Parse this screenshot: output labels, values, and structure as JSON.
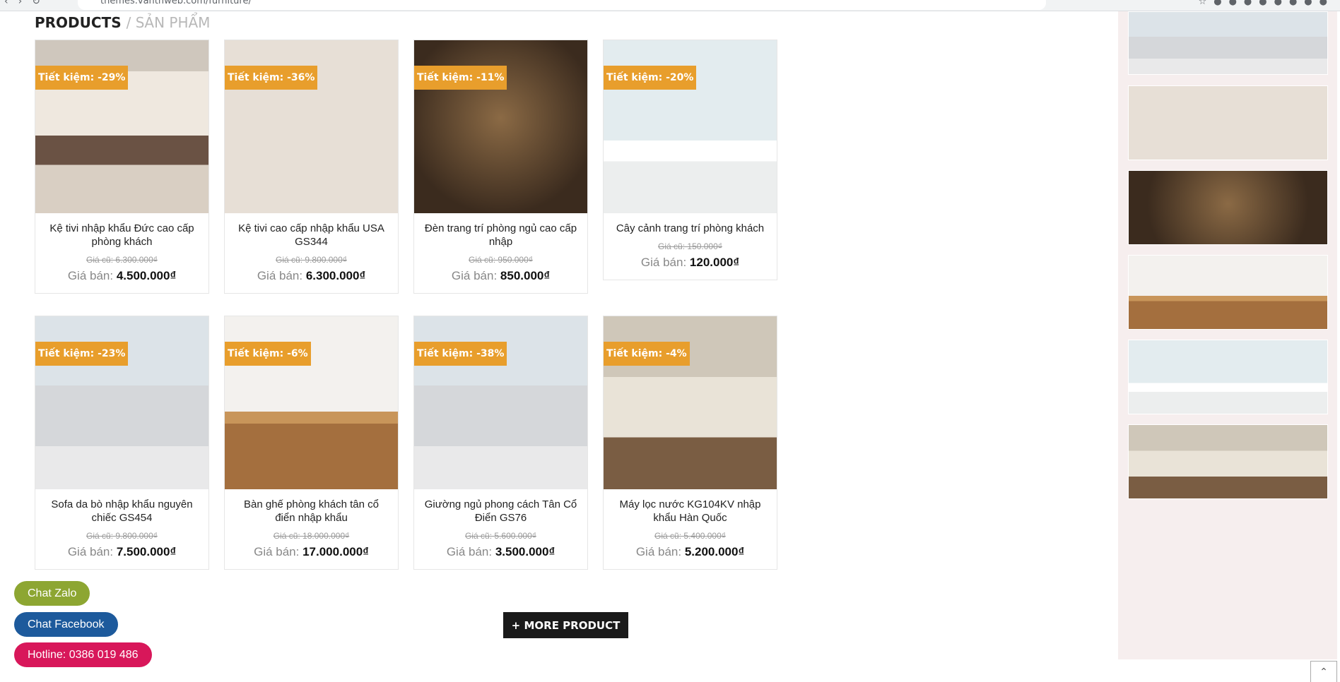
{
  "browser": {
    "url": "themes.vanthweb.com/furniture/"
  },
  "section": {
    "title_en": "PRODUCTS",
    "title_vi": "/ SẢN PHẨM"
  },
  "products": [
    {
      "badge": "Tiết kiệm: -29%",
      "name": "Kệ tivi nhập khẩu Đức cao cấp phòng khách",
      "old_price": "Giá cũ: 6.300.000₫",
      "price_label": "Giá bán:",
      "price": "4.500.000₫",
      "image": "living-room"
    },
    {
      "badge": "Tiết kiệm: -36%",
      "name": "Kệ tivi cao cấp nhập khẩu USA GS344",
      "old_price": "Giá cũ: 9.800.000₫",
      "price_label": "Giá bán:",
      "price": "6.300.000₫",
      "image": "tv-shelf"
    },
    {
      "badge": "Tiết kiệm: -11%",
      "name": "Đèn trang trí phòng ngủ cao cấp nhập",
      "old_price": "Giá cũ: 950.000₫",
      "price_label": "Giá bán:",
      "price": "850.000₫",
      "image": "edison-bulbs"
    },
    {
      "badge": "Tiết kiệm: -20%",
      "name": "Cây cảnh trang trí phòng khách",
      "old_price": "Giá cũ: 150.000₫",
      "price_label": "Giá bán:",
      "price": "120.000₫",
      "image": "potted-plants"
    },
    {
      "badge": "Tiết kiệm: -23%",
      "name": "Sofa da bò nhập khẩu nguyên chiếc GS454",
      "old_price": "Giá cũ: 9.800.000₫",
      "price_label": "Giá bán:",
      "price": "7.500.000₫",
      "image": "grey-sofa"
    },
    {
      "badge": "Tiết kiệm: -6%",
      "name": "Bàn ghế phòng khách tân cổ điển nhập khẩu",
      "old_price": "Giá cũ: 18.000.000₫",
      "price_label": "Giá bán:",
      "price": "17.000.000₫",
      "image": "dining-set"
    },
    {
      "badge": "Tiết kiệm: -38%",
      "name": "Giường ngủ phong cách Tân Cổ Điển GS76",
      "old_price": "Giá cũ: 5.600.000₫",
      "price_label": "Giá bán:",
      "price": "3.500.000₫",
      "image": "grey-sofa"
    },
    {
      "badge": "Tiết kiệm: -4%",
      "name": "Máy lọc nước KG104KV nhập khẩu Hàn Quốc",
      "old_price": "Giá cũ: 5.400.000₫",
      "price_label": "Giá bán:",
      "price": "5.200.000₫",
      "image": "restaurant"
    }
  ],
  "sidebar_images": [
    "grey-sofa",
    "tv-shelf",
    "edison-bulbs",
    "dining-set",
    "potted-plants",
    "restaurant"
  ],
  "more_button": "+ MORE PRODUCT",
  "float_buttons": {
    "zalo": "Chat Zalo",
    "facebook": "Chat Facebook",
    "hotline": "Hotline: 0386 019 486"
  },
  "scroll_top_icon": "chevron-up-icon",
  "colors": {
    "badge": "#e89e2c",
    "zalo": "#8da632",
    "facebook": "#1d5a9c",
    "hotline": "#d8175a",
    "sidebar_bg": "#f6eeee"
  }
}
